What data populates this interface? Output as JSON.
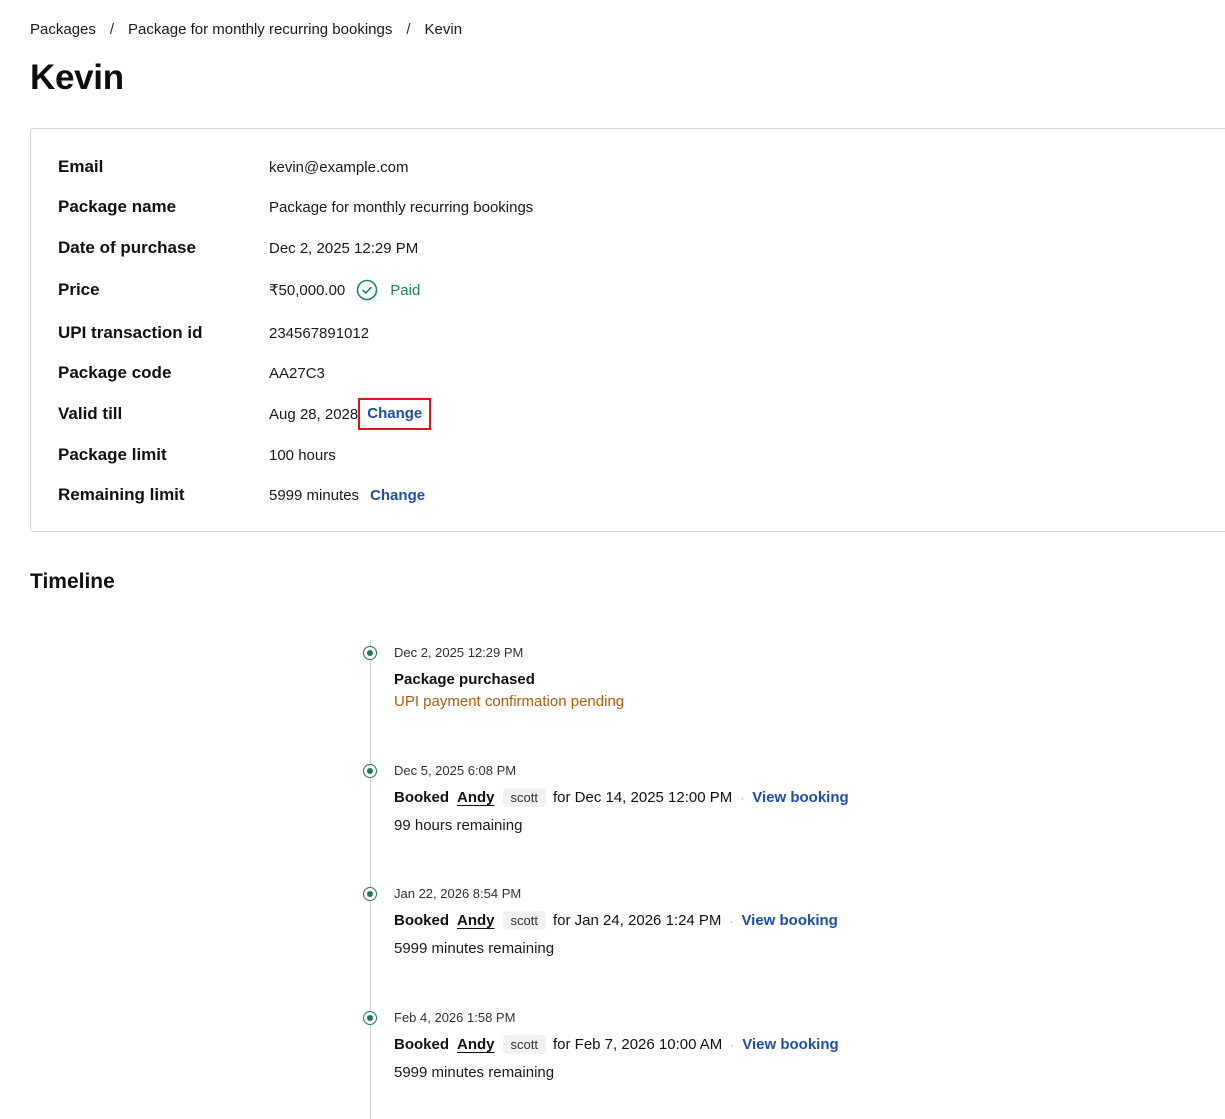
{
  "breadcrumb": {
    "items": [
      "Packages",
      "Package for monthly recurring bookings",
      "Kevin"
    ],
    "separator": "/"
  },
  "page_title": "Kevin",
  "details": {
    "email": {
      "label": "Email",
      "value": "kevin@example.com"
    },
    "package_name": {
      "label": "Package name",
      "value": "Package for monthly recurring bookings"
    },
    "date_of_purchase": {
      "label": "Date of purchase",
      "value": "Dec 2, 2025 12:29 PM"
    },
    "price": {
      "label": "Price",
      "value": "₹50,000.00",
      "status": "Paid",
      "status_color": "#1b8a54"
    },
    "upi_transaction_id": {
      "label": "UPI transaction id",
      "value": "234567891012"
    },
    "package_code": {
      "label": "Package code",
      "value": "AA27C3"
    },
    "valid_till": {
      "label": "Valid till",
      "value": "Aug 28, 2028",
      "change_label": "Change"
    },
    "package_limit": {
      "label": "Package limit",
      "value": "100 hours"
    },
    "remaining_limit": {
      "label": "Remaining limit",
      "value": "5999 minutes",
      "change_label": "Change"
    }
  },
  "timeline": {
    "title": "Timeline",
    "events": [
      {
        "time": "Dec 2, 2025 12:29 PM",
        "title": "Package purchased",
        "note": "UPI payment confirmation pending"
      },
      {
        "time": "Dec 5, 2025 6:08 PM",
        "action": "Booked",
        "user": "Andy",
        "tag": "scott",
        "for_text": "for Dec 14, 2025 12:00 PM",
        "link": "View booking",
        "remaining": "99 hours remaining"
      },
      {
        "time": "Jan 22, 2026 8:54 PM",
        "action": "Booked",
        "user": "Andy",
        "tag": "scott",
        "for_text": "for Jan 24, 2026 1:24 PM",
        "link": "View booking",
        "remaining": "5999 minutes remaining"
      },
      {
        "time": "Feb 4, 2026 1:58 PM",
        "action": "Booked",
        "user": "Andy",
        "tag": "scott",
        "for_text": "for Feb 7, 2026 10:00 AM",
        "link": "View booking",
        "remaining": "5999 minutes remaining"
      }
    ]
  },
  "colors": {
    "link": "#1f4fa8",
    "success": "#1b8a54",
    "warning": "#b65a0b",
    "timeline_dot": "#1d7a52",
    "highlight_border": "#e0141b"
  }
}
